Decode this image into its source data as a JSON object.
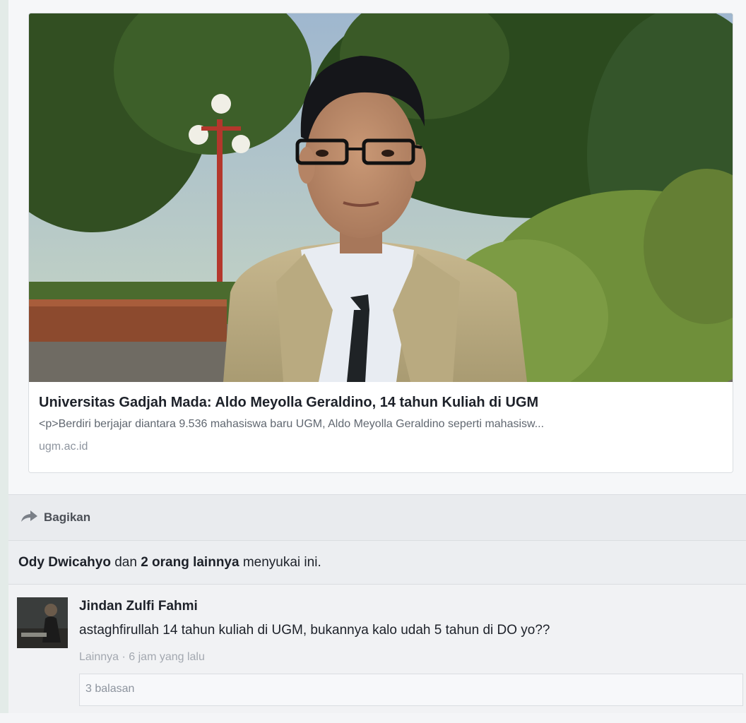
{
  "link_preview": {
    "title": "Universitas Gadjah Mada: Aldo Meyolla Geraldino, 14 tahun Kuliah di UGM",
    "description": "<p>Berdiri berjajar diantara 9.536 mahasiswa baru UGM, Aldo Meyolla Geraldino seperti mahasisw...",
    "domain": "ugm.ac.id"
  },
  "actions": {
    "share_label": "Bagikan",
    "share_icon": "share-arrow-icon"
  },
  "likes": {
    "name": "Ody Dwicahyo",
    "connector": " dan ",
    "others": "2 orang lainnya",
    "suffix": " menyukai ini."
  },
  "comment": {
    "author": "Jindan Zulfi Fahmi",
    "text": "astaghfirullah 14 tahun kuliah di UGM, bukannya kalo udah 5 tahun di DO yo??",
    "more_label": "Lainnya",
    "separator": " · ",
    "time": "6 jam yang lalu",
    "replies_label": "3 balasan"
  },
  "colors": {
    "title_text": "#1d2129",
    "secondary_text": "#606770",
    "muted_text": "#8d949e",
    "share_bar_bg": "#e9ebee"
  }
}
